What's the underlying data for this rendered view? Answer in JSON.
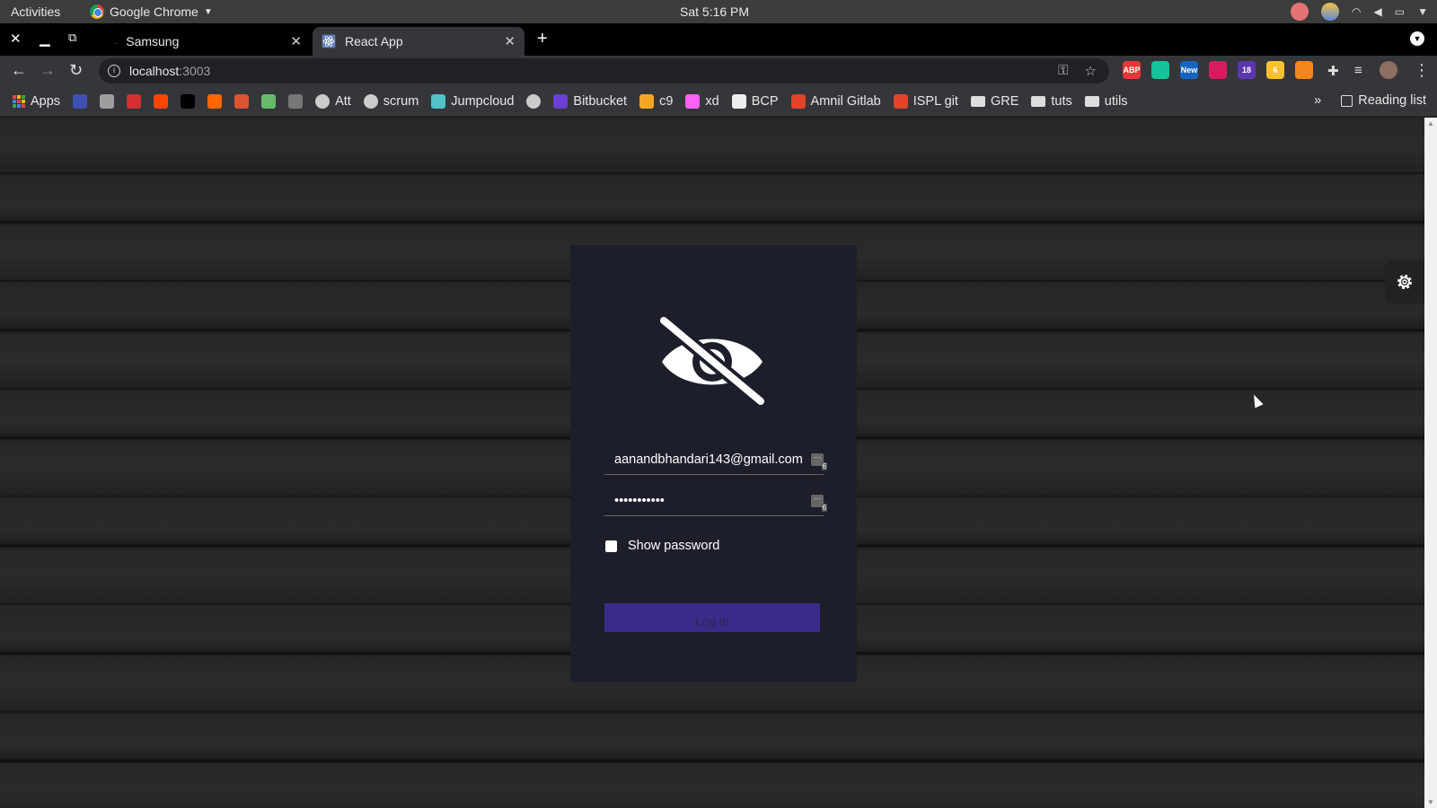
{
  "system_bar": {
    "activities": "Activities",
    "app_name": "Google Chrome",
    "clock": "Sat  5:16 PM"
  },
  "tabs": [
    {
      "title": "Samsung",
      "active": false
    },
    {
      "title": "React App",
      "active": true
    }
  ],
  "toolbar": {
    "url_host": "localhost",
    "url_port": ":3003",
    "extensions": [
      {
        "name": "adblock-icon",
        "label": "ABP",
        "color": "#e53935"
      },
      {
        "name": "grammarly-icon",
        "label": "",
        "color": "#15c39a"
      },
      {
        "name": "new-extension-icon",
        "label": "New",
        "color": "#1565c0"
      },
      {
        "name": "extension-red-icon",
        "label": "",
        "color": "#d81b60"
      },
      {
        "name": "extension-badge-icon",
        "label": "18",
        "color": "#5e35b1"
      },
      {
        "name": "sticky-notes-icon",
        "label": "6",
        "color": "#fbc02d"
      },
      {
        "name": "metamask-icon",
        "label": "",
        "color": "#f6851b"
      }
    ]
  },
  "bookmarks": {
    "apps": "Apps",
    "items": [
      {
        "label": "",
        "icon": "bm-blue-icon",
        "color": "#3f51b5"
      },
      {
        "label": "",
        "icon": "bm-swirl-icon",
        "color": "#9e9e9e"
      },
      {
        "label": "",
        "icon": "js-icon",
        "color": "#d32f2f"
      },
      {
        "label": "",
        "icon": "reddit-icon",
        "color": "#ff4500"
      },
      {
        "label": "",
        "icon": "medium-icon",
        "color": "#000000"
      },
      {
        "label": "",
        "icon": "ycombinator-icon",
        "color": "#ff6600"
      },
      {
        "label": "",
        "icon": "producthunt-icon",
        "color": "#da552f"
      },
      {
        "label": "",
        "icon": "owl-icon",
        "color": "#66bb6a"
      },
      {
        "label": "",
        "icon": "cloud-icon",
        "color": "#777777"
      },
      {
        "label": "Att",
        "icon": "globe-icon",
        "color": "#cccccc"
      },
      {
        "label": "scrum",
        "icon": "globe-icon",
        "color": "#cccccc"
      },
      {
        "label": "Jumpcloud",
        "icon": "jumpcloud-icon",
        "color": "#4fc3c7"
      },
      {
        "label": "",
        "icon": "globe-icon",
        "color": "#cccccc"
      },
      {
        "label": "Bitbucket",
        "icon": "bitbucket-icon",
        "color": "#6a3fd1"
      },
      {
        "label": "c9",
        "icon": "c9-icon",
        "color": "#f5a623"
      },
      {
        "label": "xd",
        "icon": "xd-icon",
        "color": "#ff61f6"
      },
      {
        "label": "BCP",
        "icon": "bcp-icon",
        "color": "#eeeeee"
      },
      {
        "label": "Amnil Gitlab",
        "icon": "gitlab-icon",
        "color": "#e24329"
      },
      {
        "label": "ISPL git",
        "icon": "gitlab-icon",
        "color": "#e24329"
      },
      {
        "label": "GRE",
        "icon": "folder-icon",
        "color": "#dddddd"
      },
      {
        "label": "tuts",
        "icon": "folder-icon",
        "color": "#dddddd"
      },
      {
        "label": "utils",
        "icon": "folder-icon",
        "color": "#dddddd"
      }
    ],
    "more": "»",
    "reading_list": "Reading list"
  },
  "login": {
    "email": "aanandbhandari143@gmail.com",
    "password": "•••••••••••",
    "password_badge": "6",
    "email_badge": "6",
    "show_password": "Show password",
    "login_button": "Log in"
  },
  "colors": {
    "card_bg": "#1c1f2a",
    "button_bg": "#3a2a8a"
  }
}
